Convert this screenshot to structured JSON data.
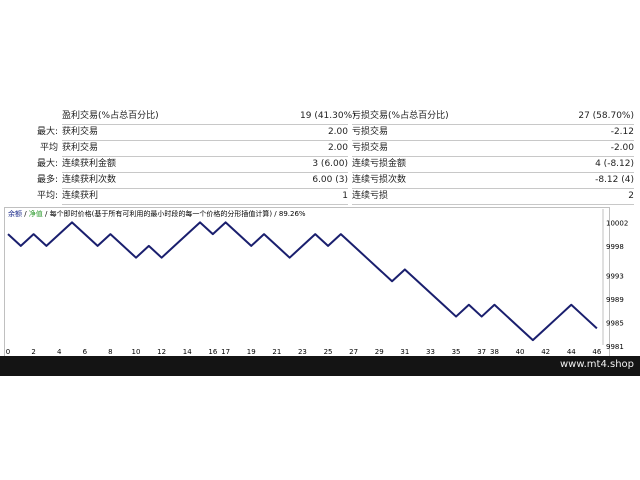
{
  "stats": {
    "rows": [
      {
        "l1": "",
        "t1": "盈利交易(%占总百分比)",
        "v1": "19 (41.30%)",
        "t2": "亏损交易(%占总百分比)",
        "v2": "27 (58.70%)"
      },
      {
        "l1": "最大:",
        "t1": "获利交易",
        "v1": "2.00",
        "t2": "亏损交易",
        "v2": "-2.12"
      },
      {
        "l1": "平均",
        "t1": "获利交易",
        "v1": "2.00",
        "t2": "亏损交易",
        "v2": "-2.00"
      },
      {
        "l1": "最大:",
        "t1": "连续获利金额",
        "v1": "3 (6.00)",
        "t2": "连续亏损金额",
        "v2": "4 (-8.12)"
      },
      {
        "l1": "最多:",
        "t1": "连续获利次数",
        "v1": "6.00 (3)",
        "t2": "连续亏损次数",
        "v2": "-8.12 (4)"
      },
      {
        "l1": "平均:",
        "t1": "连续获利",
        "v1": "1",
        "t2": "连续亏损",
        "v2": "2"
      }
    ]
  },
  "legend": {
    "part1": "余额",
    "sep1": " / ",
    "part2": "净值",
    "sep2": " / ",
    "part3": "每个即时价格(基于所有可利用的最小时段的每一个价格的分形插值计算) / 89.26%"
  },
  "chart_data": {
    "type": "line",
    "x": [
      0,
      1,
      2,
      3,
      4,
      5,
      6,
      7,
      8,
      9,
      10,
      11,
      12,
      13,
      14,
      15,
      16,
      17,
      18,
      19,
      20,
      21,
      22,
      23,
      24,
      25,
      26,
      27,
      28,
      29,
      30,
      31,
      32,
      33,
      34,
      35,
      36,
      37,
      38,
      39,
      40,
      41,
      42,
      43,
      44,
      45,
      46
    ],
    "series": [
      {
        "values": [
          10000,
          9998,
          10000,
          9998,
          10000,
          10002,
          10000,
          9998,
          10000,
          9998,
          9996,
          9998,
          9996,
          9998,
          10000,
          10002,
          10000,
          10002,
          10000,
          9998,
          10000,
          9998,
          9996,
          9998,
          10000,
          9998,
          10000,
          9998,
          9996,
          9994,
          9992,
          9994,
          9992,
          9990,
          9988,
          9986,
          9988,
          9986,
          9988,
          9986,
          9984,
          9982,
          9984,
          9986,
          9988,
          9986,
          9984
        ]
      }
    ],
    "xticks": [
      0,
      2,
      4,
      6,
      8,
      10,
      12,
      14,
      16,
      17,
      19,
      21,
      23,
      25,
      27,
      29,
      31,
      33,
      35,
      37,
      38,
      40,
      42,
      44,
      46
    ],
    "yticks": [
      10002,
      9998,
      9993,
      9989,
      9985,
      9981
    ],
    "ylim": [
      9981,
      10002.4
    ],
    "xlim": [
      0,
      46.4
    ],
    "grid": false,
    "line_color": "#1a1f6e"
  },
  "footer": {
    "brand": "www.mt4.shop"
  }
}
